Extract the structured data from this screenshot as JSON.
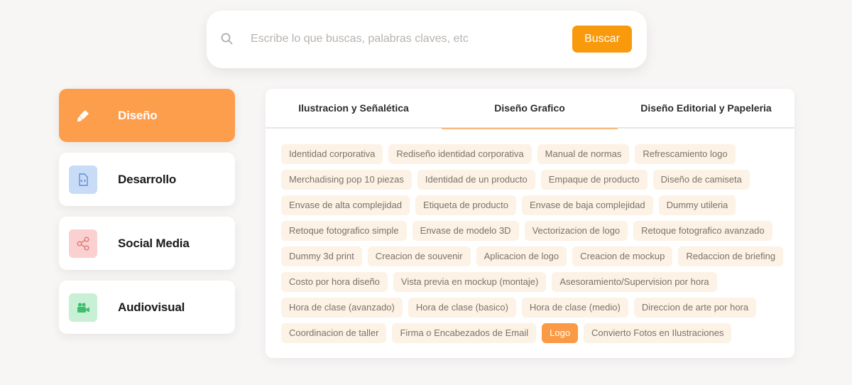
{
  "search": {
    "placeholder": "Escribe lo que buscas, palabras claves, etc",
    "button_label": "Buscar"
  },
  "sidebar": {
    "items": [
      {
        "label": "Diseño",
        "icon": "brush-icon",
        "color": "#fd9e4d",
        "active": true
      },
      {
        "label": "Desarrollo",
        "icon": "code-file-icon",
        "color": "#c9dcf7"
      },
      {
        "label": "Social Media",
        "icon": "share-icon",
        "color": "#fbd0d0"
      },
      {
        "label": "Audiovisual",
        "icon": "video-camera-icon",
        "color": "#c7f0d4"
      }
    ]
  },
  "tabs": [
    {
      "label": "Ilustracion y Señalética"
    },
    {
      "label": "Diseño Grafico",
      "active": true
    },
    {
      "label": "Diseño Editorial y Papeleria"
    }
  ],
  "tags": [
    [
      "Identidad corporativa",
      "Rediseño identidad corporativa",
      "Manual de normas",
      "Refrescamiento logo"
    ],
    [
      "Merchadising pop 10 piezas",
      "Identidad de un producto",
      "Empaque de producto",
      "Diseño de camiseta"
    ],
    [
      "Envase de alta complejidad",
      "Etiqueta de producto",
      "Envase de baja complejidad",
      "Dummy utileria"
    ],
    [
      "Retoque fotografico simple",
      "Envase de modelo 3D",
      "Vectorizacion de logo",
      "Retoque fotografico avanzado"
    ],
    [
      "Dummy 3d print",
      "Creacion de souvenir",
      "Aplicacion de logo",
      "Creacion de mockup",
      "Redaccion de briefing"
    ],
    [
      "Costo por hora diseño",
      "Vista previa en mockup (montaje)",
      "Asesoramiento/Supervision por hora"
    ],
    [
      "Hora de clase (avanzado)",
      "Hora de clase (basico)",
      "Hora de clase (medio)",
      "Direccion de arte por hora"
    ],
    [
      "Coordinacion de taller",
      "Firma o Encabezados de Email",
      "Logo",
      "Convierto Fotos en Ilustraciones"
    ]
  ],
  "selected_tag": "Logo",
  "colors": {
    "accent": "#f99a0c",
    "active_card": "#fd9e4d",
    "tag_bg": "#fcf2e5",
    "tag_selected": "#fa9a45"
  }
}
